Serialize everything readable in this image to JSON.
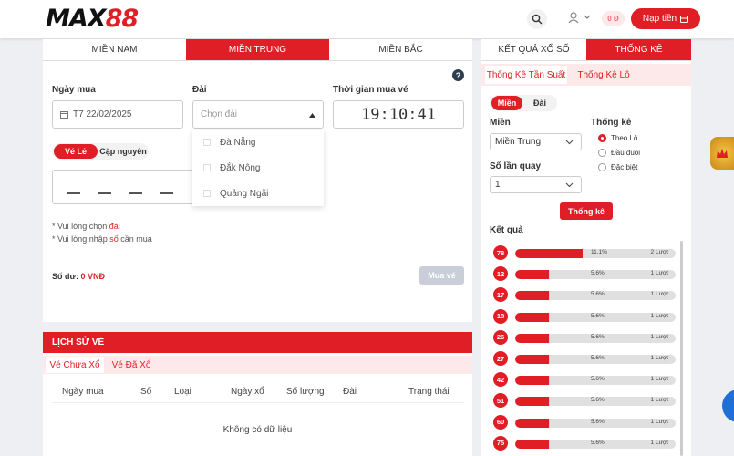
{
  "header": {
    "logo_text": "MAX",
    "logo_num": "88",
    "balance": "0 Đ",
    "deposit_label": "Nạp tiền"
  },
  "regions": {
    "tabs": [
      "MIỀN NAM",
      "MIỀN TRUNG",
      "MIỀN BẮC"
    ],
    "active": "MIỀN TRUNG"
  },
  "form": {
    "date_label": "Ngày mua",
    "date_value": "T7 22/02/2025",
    "station_label": "Đài",
    "station_placeholder": "Chọn đài",
    "time_label": "Thời gian mua vé",
    "time_value": "19:10:41",
    "ticket_types": [
      "Vé Lẻ",
      "Cặp nguyên"
    ],
    "station_options": [
      "Đà Nẵng",
      "Đắk Nông",
      "Quảng Ngãi"
    ],
    "note1_prefix": "* Vui lòng chọn ",
    "note1_hl": "đài",
    "note2_prefix": "* Vui lòng nhập ",
    "note2_hl": "số",
    "note2_suffix": " cần mua",
    "balance_label": "Số dư: ",
    "balance_value": "0 VNĐ",
    "buy_label": "Mua vé"
  },
  "history": {
    "title": "LỊCH SỬ VÉ",
    "tabs": [
      "Vé Chưa Xổ",
      "Vé Đã Xổ"
    ],
    "columns": [
      "Ngày mua",
      "Số",
      "Loại",
      "Ngày xổ",
      "Số lượng",
      "Đài",
      "Trạng thái"
    ],
    "empty": "Không có dữ liệu"
  },
  "right": {
    "top_tabs": [
      "KẾT QUẢ XỔ SỐ",
      "THỐNG KÊ"
    ],
    "sub_tabs": [
      "Thống Kê Tần Suất",
      "Thống Kê Lô"
    ],
    "toggle": [
      "Miền",
      "Đài"
    ],
    "region_label": "Miền",
    "region_value": "Miền Trung",
    "spins_label": "Số lần quay",
    "spins_value": "1",
    "stat_label": "Thống kê",
    "stat_options": [
      "Theo Lô",
      "Đầu đuôi",
      "Đặc biệt"
    ],
    "stat_button": "Thống kê",
    "results_label": "Kết quả"
  },
  "results": [
    {
      "num": "78",
      "pct": "11.1%",
      "count": "2 Lượt",
      "value": 11.1
    },
    {
      "num": "12",
      "pct": "5.6%",
      "count": "1 Lượt",
      "value": 5.6
    },
    {
      "num": "17",
      "pct": "5.6%",
      "count": "1 Lượt",
      "value": 5.6
    },
    {
      "num": "18",
      "pct": "5.6%",
      "count": "1 Lượt",
      "value": 5.6
    },
    {
      "num": "26",
      "pct": "5.6%",
      "count": "1 Lượt",
      "value": 5.6
    },
    {
      "num": "27",
      "pct": "5.6%",
      "count": "1 Lượt",
      "value": 5.6
    },
    {
      "num": "42",
      "pct": "5.6%",
      "count": "1 Lượt",
      "value": 5.6
    },
    {
      "num": "51",
      "pct": "5.6%",
      "count": "1 Lượt",
      "value": 5.6
    },
    {
      "num": "60",
      "pct": "5.6%",
      "count": "1 Lượt",
      "value": 5.6
    },
    {
      "num": "75",
      "pct": "5.6%",
      "count": "1 Lượt",
      "value": 5.6
    }
  ]
}
